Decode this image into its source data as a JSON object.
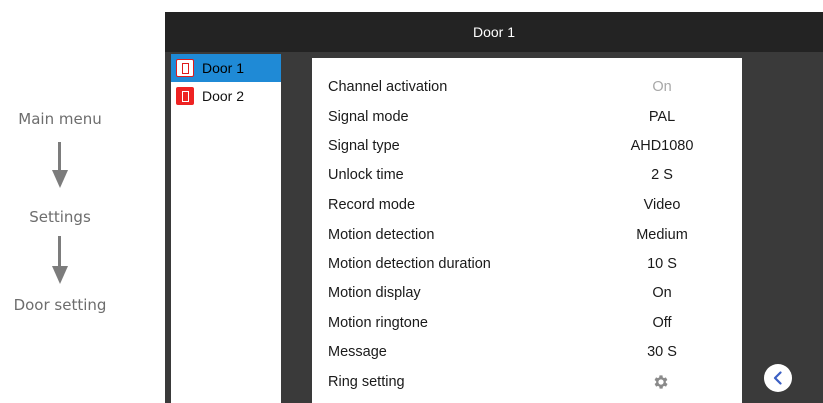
{
  "guide": {
    "steps": [
      "Main menu",
      "Settings",
      "Door setting"
    ]
  },
  "screen": {
    "title": "Door 1",
    "doors": [
      {
        "label": "Door 1",
        "selected": true
      },
      {
        "label": "Door 2",
        "selected": false
      }
    ],
    "settings": [
      {
        "label": "Channel activation",
        "value": "On",
        "dimmed": true
      },
      {
        "label": "Signal mode",
        "value": "PAL"
      },
      {
        "label": "Signal type",
        "value": "AHD1080"
      },
      {
        "label": "Unlock time",
        "value": "2 S"
      },
      {
        "label": "Record mode",
        "value": "Video"
      },
      {
        "label": "Motion detection",
        "value": "Medium"
      },
      {
        "label": "Motion detection duration",
        "value": "10 S"
      },
      {
        "label": "Motion display",
        "value": "On"
      },
      {
        "label": "Motion ringtone",
        "value": "Off"
      },
      {
        "label": "Message",
        "value": "30 S"
      },
      {
        "label": "Ring setting",
        "icon": "gear-icon"
      }
    ],
    "back_icon": "chevron-left-icon",
    "colors": {
      "screen_bg": "#3a3a3a",
      "titlebar_bg": "#232323",
      "selection": "#1f8ad6",
      "door_icon": "#ee2222",
      "dim_value": "#a8a8a8"
    }
  }
}
